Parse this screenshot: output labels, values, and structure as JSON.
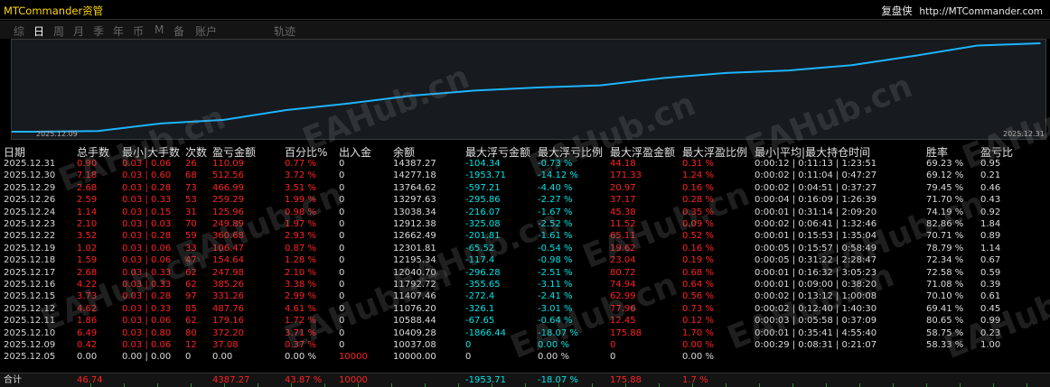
{
  "app": {
    "title": "MTCommander资管",
    "header_right": "复盘侠",
    "url": "http://MTCommander.com"
  },
  "tabs": [
    "综",
    "日",
    "周",
    "月",
    "季",
    "年",
    "币",
    "M",
    "备",
    "账户",
    "轨迹"
  ],
  "active_tab": "日",
  "chart": {
    "start_label": "2025.12.09",
    "end_label": "2025.12.31",
    "line_color": "#1eb4ff",
    "balances": [
      10000.0,
      10037.08,
      10409.28,
      10588.44,
      11076.2,
      11407.46,
      11792.72,
      12040.7,
      12195.34,
      12301.81,
      12662.49,
      12912.38,
      13038.34,
      13297.63,
      13764.62,
      14277.18,
      14387.27
    ]
  },
  "watermark": "EAHub.cn",
  "columns": [
    "日期",
    "总手数",
    "最小|大手数",
    "次数",
    "盈亏金额",
    "百分比%",
    "出入金",
    "余额",
    "最大浮亏金额",
    "最大浮亏比例",
    "最大浮盈金额",
    "最大浮盈比例",
    "最小|平均|最大持仓时间",
    "胜率",
    "盈亏比"
  ],
  "rows": [
    [
      "2025.12.31",
      "0.90",
      "0.03 | 0.06",
      "26",
      "110.09",
      "0.77 %",
      "0",
      "14387.27",
      "-104.34",
      "-0.73 %",
      "44.18",
      "0.31 %",
      "0:00:12 | 0:11:13 | 1:23:51",
      "69.23 %",
      "0.95"
    ],
    [
      "2025.12.30",
      "7.18",
      "0.03 | 0.60",
      "68",
      "512.56",
      "3.72 %",
      "0",
      "14277.18",
      "-1953.71",
      "-14.12 %",
      "171.33",
      "1.24 %",
      "0:00:02 | 0:11:04 | 0:47:27",
      "69.12 %",
      "0.21"
    ],
    [
      "2025.12.29",
      "2.68",
      "0.03 | 0.28",
      "73",
      "466.99",
      "3.51 %",
      "0",
      "13764.62",
      "-597.21",
      "-4.40 %",
      "20.97",
      "0.16 %",
      "0:00:02 | 0:04:51 | 0:37:27",
      "79.45 %",
      "0.46"
    ],
    [
      "2025.12.26",
      "2.59",
      "0.03 | 0.33",
      "53",
      "259.29",
      "1.99 %",
      "0",
      "13297.63",
      "-295.86",
      "-2.27 %",
      "37.17",
      "0.28 %",
      "0:00:04 | 0:16:09 | 1:26:39",
      "71.70 %",
      "0.43"
    ],
    [
      "2025.12.24",
      "1.14",
      "0.03 | 0.15",
      "31",
      "125.96",
      "0.98 %",
      "0",
      "13038.34",
      "-216.07",
      "-1.67 %",
      "45.38",
      "0.35 %",
      "0:00:01 | 0:31:14 | 2:09:20",
      "74.19 %",
      "0.92"
    ],
    [
      "2025.12.23",
      "2.10",
      "0.03 | 0.03",
      "70",
      "249.89",
      "1.97 %",
      "0",
      "12912.38",
      "-325.08",
      "-2.52 %",
      "11.52",
      "0.09 %",
      "0:00:02 | 0:06:41 | 1:32:46",
      "82.86 %",
      "1.84"
    ],
    [
      "2025.12.22",
      "3.52",
      "0.03 | 0.28",
      "59",
      "360.68",
      "2.93 %",
      "0",
      "12662.49",
      "-201.81",
      "-1.61 %",
      "65.11",
      "0.52 %",
      "0:00:01 | 0:15:53 | 1:35:04",
      "70.71 %",
      "0.89"
    ],
    [
      "2025.12.19",
      "1.02",
      "0.03 | 0.06",
      "33",
      "106.47",
      "0.87 %",
      "0",
      "12301.81",
      "-65.52",
      "-0.54 %",
      "19.62",
      "0.16 %",
      "0:00:05 | 0:15:57 | 0:58:49",
      "78.79 %",
      "1.14"
    ],
    [
      "2025.12.18",
      "1.59",
      "0.03 | 0.06",
      "47",
      "154.64",
      "1.28 %",
      "0",
      "12195.34",
      "-117.4",
      "-0.98 %",
      "23.04",
      "0.19 %",
      "0:00:05 | 0:31:22 | 2:28:47",
      "72.34 %",
      "0.67"
    ],
    [
      "2025.12.17",
      "2.68",
      "0.03 | 0.33",
      "62",
      "247.98",
      "2.10 %",
      "0",
      "12040.70",
      "-296.28",
      "-2.51 %",
      "80.72",
      "0.68 %",
      "0:00:01 | 0:16:32 | 3:05:23",
      "72.58 %",
      "0.59"
    ],
    [
      "2025.12.16",
      "4.22",
      "0.03 | 0.33",
      "62",
      "385.26",
      "3.38 %",
      "0",
      "11792.72",
      "-355.65",
      "-3.11 %",
      "74.94",
      "0.64 %",
      "0:00:01 | 0:09:00 | 0:38:20",
      "71.08 %",
      "0.39"
    ],
    [
      "2025.12.15",
      "3.73",
      "0.03 | 0.28",
      "97",
      "331.26",
      "2.99 %",
      "0",
      "11407.46",
      "-272.4",
      "-2.41 %",
      "62.99",
      "0.56 %",
      "0:00:02 | 0:13:12 | 1:00:08",
      "70.10 %",
      "0.61"
    ],
    [
      "2025.12.12",
      "4.62",
      "0.03 | 0.33",
      "85",
      "487.76",
      "4.61 %",
      "0",
      "11076.20",
      "-326.1",
      "-3.01 %",
      "77.96",
      "0.73 %",
      "0:00:02 | 0:12:40 | 1:40:30",
      "69.41 %",
      "0.45"
    ],
    [
      "2025.12.11",
      "1.86",
      "0.03 | 0.06",
      "62",
      "179.16",
      "1.72 %",
      "0",
      "10588.44",
      "-67.65",
      "-0.64 %",
      "12.45",
      "0.12 %",
      "0:00:03 | 0:05:58 | 0:37:09",
      "80.65 %",
      "0.99"
    ],
    [
      "2025.12.10",
      "6.49",
      "0.03 | 0.80",
      "80",
      "372.20",
      "3.71 %",
      "0",
      "10409.28",
      "-1866.44",
      "-18.07 %",
      "175.88",
      "1.70 %",
      "0:00:01 | 0:35:41 | 4:55:40",
      "58.75 %",
      "0.23"
    ],
    [
      "2025.12.09",
      "0.42",
      "0.03 | 0.06",
      "12",
      "37.08",
      "0.37 %",
      "0",
      "10037.08",
      "0",
      "0.00 %",
      "0",
      "0.00 %",
      "0:00:29 | 0:08:31 | 0:21:07",
      "58.33 %",
      "1.00"
    ],
    [
      "2025.12.05",
      "0.00",
      "0.00 | 0.00",
      "0",
      "0.00",
      "0.00 %",
      "10000",
      "10000.00",
      "0",
      "0.00 %",
      "0",
      "0.00 %",
      "",
      "",
      ""
    ]
  ],
  "totals": [
    "合计",
    "46.74",
    "",
    "",
    "4387.27",
    "43.87 %",
    "10000",
    "",
    "-1953.71",
    "-18.07 %",
    "175.88",
    "1.7 %",
    "",
    "",
    ""
  ],
  "colors": {
    "red": "#ff2222",
    "cyan": "#00e5e5",
    "gold": "#ffd700",
    "line": "#1eb4ff"
  }
}
